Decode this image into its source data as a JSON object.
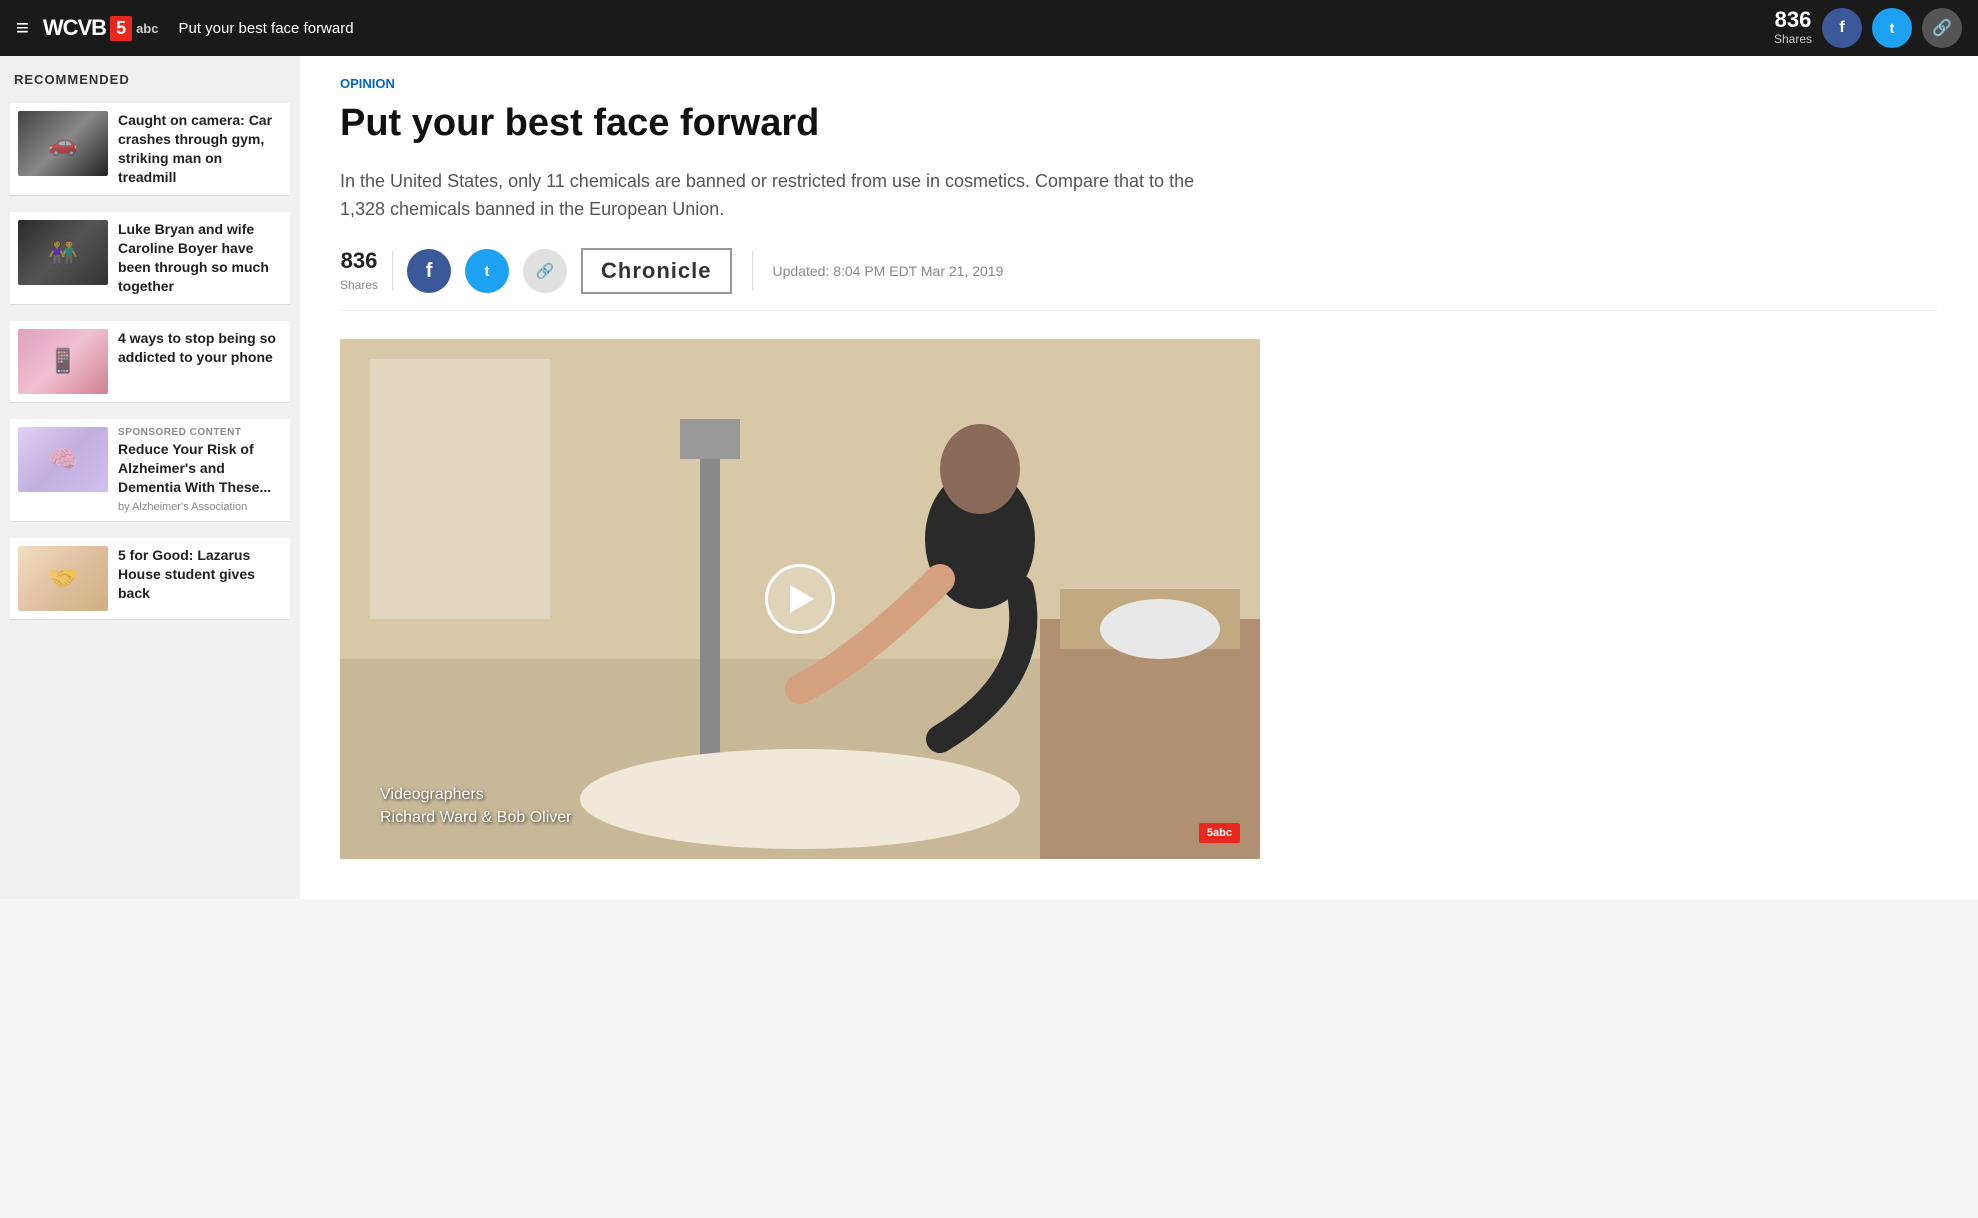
{
  "nav": {
    "hamburger_label": "☰",
    "logo_wcvb": "WCVB",
    "logo_num": "5",
    "logo_abc": "abc",
    "article_title_nav": "Put your best face forward",
    "shares_count": "836",
    "shares_label": "Shares",
    "facebook_icon": "f",
    "twitter_icon": "t",
    "link_icon": "🔗"
  },
  "sidebar": {
    "title": "RECOMMENDED",
    "items": [
      {
        "id": "car-crash",
        "title": "Caught on camera: Car crashes through gym, striking man on treadmill",
        "sponsored": false,
        "byline": ""
      },
      {
        "id": "luke-bryan",
        "title": "Luke Bryan and wife Caroline Boyer have been through so much together",
        "sponsored": false,
        "byline": ""
      },
      {
        "id": "phone-addicted",
        "title": "4 ways to stop being so addicted to your phone",
        "sponsored": false,
        "byline": ""
      },
      {
        "id": "alzheimers",
        "title": "Reduce Your Risk of Alzheimer's and Dementia With These...",
        "sponsored": true,
        "sponsored_label": "SPONSORED CONTENT",
        "byline": "by Alzheimer's Association"
      },
      {
        "id": "five-good",
        "title": "5 for Good: Lazarus House student gives back",
        "sponsored": false,
        "byline": ""
      }
    ]
  },
  "article": {
    "category": "Opinion",
    "title": "Put your best face forward",
    "description": "In the United States, only 11 chemicals are banned or restricted from use in cosmetics. Compare that to the 1,328 chemicals banned in the European Union.",
    "shares_count": "836",
    "shares_label": "Shares",
    "chronicle_label": "Chronicle",
    "updated_text": "Updated: 8:04 PM EDT Mar 21, 2019",
    "video": {
      "caption_line1": "Videographers",
      "caption_line2": "Richard Ward & Bob Oliver",
      "logo": "5abc"
    }
  },
  "icons": {
    "facebook": "f",
    "twitter": "𝕏",
    "link": "⚭",
    "play": "▶",
    "hamburger": "≡"
  }
}
